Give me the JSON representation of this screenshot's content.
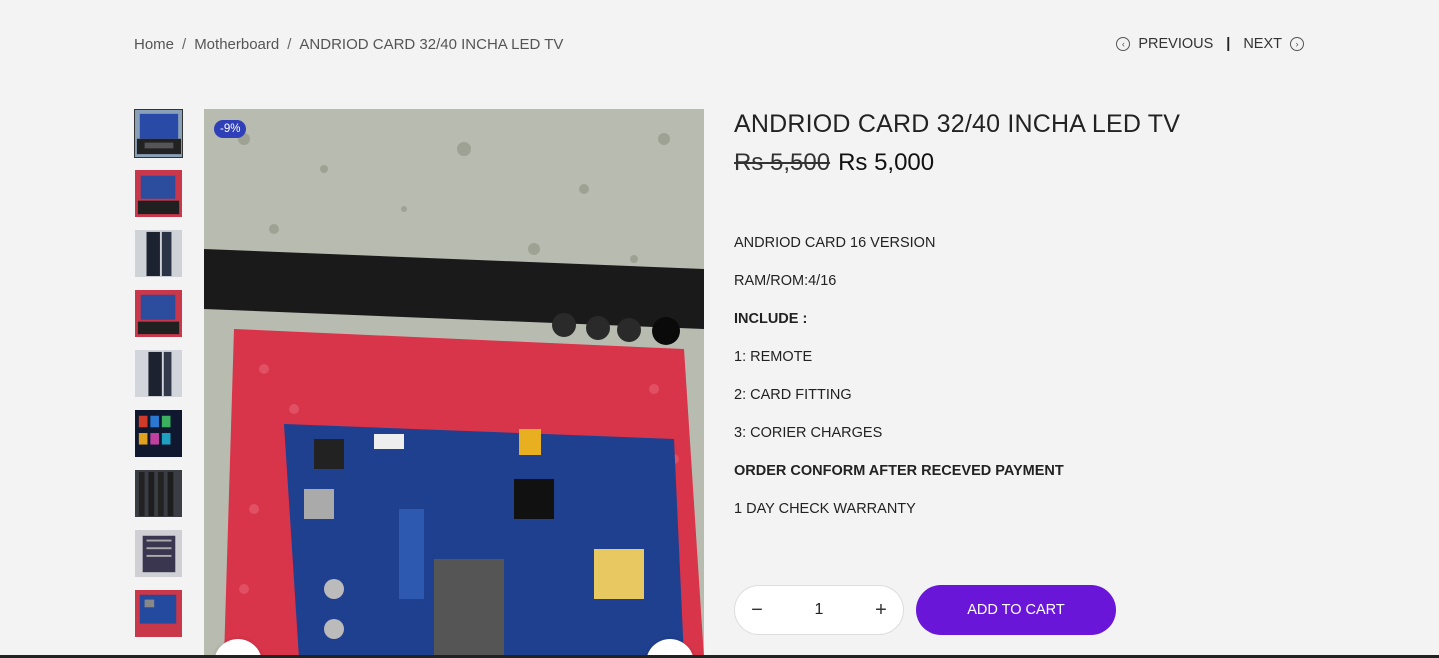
{
  "breadcrumb": {
    "home": "Home",
    "category": "Motherboard",
    "current": "ANDRIOD CARD 32/40 INCHA LED TV"
  },
  "pager": {
    "previous": "PREVIOUS",
    "divider": "|",
    "next": "NEXT"
  },
  "product": {
    "badge": "-9%",
    "title": "ANDRIOD CARD 32/40 INCHA LED TV",
    "old_price": "Rs 5,500",
    "new_price": "Rs 5,000",
    "description": [
      "ANDRIOD CARD 16 VERSION",
      "RAM/ROM:4/16",
      "INCLUDE :",
      "1: REMOTE",
      "2: CARD FITTING",
      "3: CORIER CHARGES",
      "ORDER CONFORM AFTER RECEVED PAYMENT",
      "1 DAY CHECK WARRANTY"
    ],
    "quantity": "1",
    "add_to_cart": "ADD TO CART"
  },
  "colors": {
    "accent": "#6a16d9",
    "badge": "#2f3fb7",
    "background": "#f3f3f3"
  },
  "icons": {
    "previous": "chevron-left-circle-icon",
    "next": "chevron-right-circle-icon",
    "minus": "minus-icon",
    "plus": "plus-icon"
  }
}
